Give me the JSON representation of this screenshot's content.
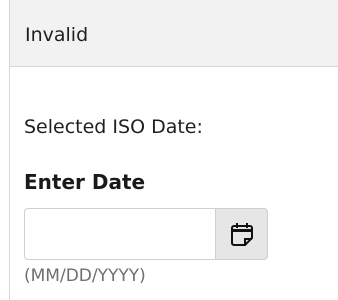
{
  "panel": {
    "header_title": "Invalid"
  },
  "form": {
    "selected_label": "Selected ISO Date:",
    "enter_label": "Enter Date",
    "date_value": "",
    "date_placeholder": "",
    "format_hint": "(MM/DD/YYYY)",
    "calendar_icon": "calendar-icon"
  }
}
